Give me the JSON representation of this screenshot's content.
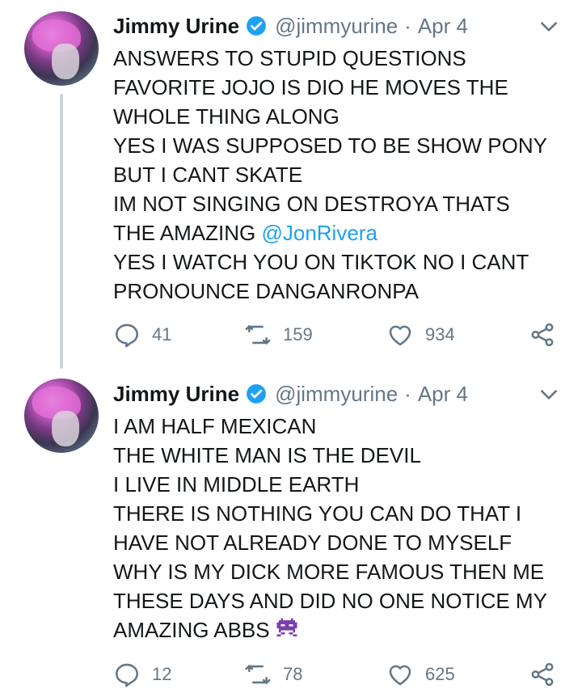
{
  "tweets": [
    {
      "name": "Jimmy Urine",
      "handle": "@jimmyurine",
      "separator": "·",
      "date": "Apr 4",
      "lines": [
        "ANSWERS TO STUPID QUESTIONS",
        "FAVORITE JOJO IS DIO HE MOVES THE",
        "WHOLE THING ALONG",
        "YES I WAS SUPPOSED TO BE SHOW PONY",
        "BUT I CANT SKATE",
        "IM NOT SINGING ON DESTROYA THATS",
        "THE AMAZING ",
        "YES I WATCH YOU ON TIKTOK NO I CANT",
        "PRONOUNCE DANGANRONPA"
      ],
      "mention": "@JonRivera",
      "replies": "41",
      "retweets": "159",
      "likes": "934"
    },
    {
      "name": "Jimmy Urine",
      "handle": "@jimmyurine",
      "separator": "·",
      "date": "Apr 4",
      "lines": [
        "I AM HALF MEXICAN",
        "THE WHITE MAN IS THE DEVIL",
        "I LIVE IN MIDDLE EARTH",
        "THERE IS NOTHING YOU CAN DO THAT I",
        "HAVE NOT ALREADY DONE TO MYSELF",
        "WHY IS MY DICK MORE FAMOUS THEN ME",
        "THESE DAYS AND DID NO ONE NOTICE MY",
        "AMAZING ABBS"
      ],
      "emoji": "alien-monster-icon",
      "replies": "12",
      "retweets": "78",
      "likes": "625"
    }
  ],
  "colors": {
    "text": "#14171a",
    "secondary": "#657786",
    "link": "#1da1f2",
    "verified": "#1da1f2",
    "thread_line": "#ccd6dd",
    "emoji": "#7b3fb0"
  },
  "icons": [
    "verified-badge-icon",
    "chevron-down-icon",
    "reply-icon",
    "retweet-icon",
    "like-icon",
    "share-icon",
    "alien-monster-icon"
  ]
}
